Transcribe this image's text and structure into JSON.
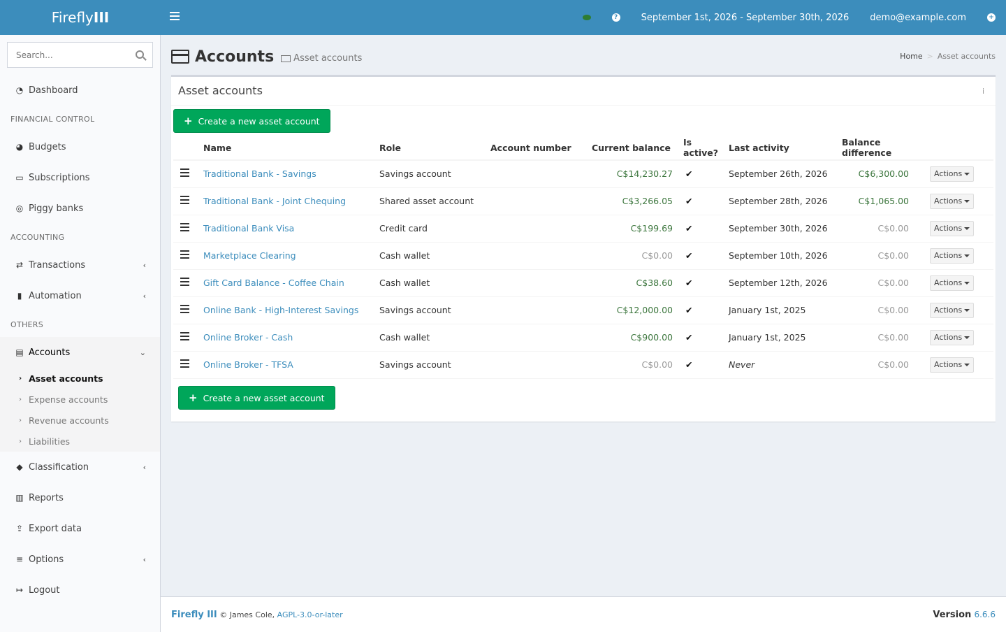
{
  "header": {
    "logo_light": "Firefly",
    "logo_bold": "III",
    "date_range": "September 1st, 2026 - September 30th, 2026",
    "user_email": "demo@example.com"
  },
  "sidebar": {
    "search_placeholder": "Search...",
    "dashboard": "Dashboard",
    "section_financial": "FINANCIAL CONTROL",
    "budgets": "Budgets",
    "subscriptions": "Subscriptions",
    "piggy_banks": "Piggy banks",
    "section_accounting": "ACCOUNTING",
    "transactions": "Transactions",
    "automation": "Automation",
    "section_others": "OTHERS",
    "accounts": "Accounts",
    "sub_asset": "Asset accounts",
    "sub_expense": "Expense accounts",
    "sub_revenue": "Revenue accounts",
    "sub_liabilities": "Liabilities",
    "classification": "Classification",
    "reports": "Reports",
    "export": "Export data",
    "options": "Options",
    "logout": "Logout"
  },
  "page": {
    "title": "Accounts",
    "subtitle": "Asset accounts",
    "breadcrumb_home": "Home",
    "breadcrumb_current": "Asset accounts"
  },
  "box": {
    "title": "Asset accounts",
    "info": "i",
    "create_label": "Create a new asset account"
  },
  "table": {
    "columns": {
      "name": "Name",
      "role": "Role",
      "account_number": "Account number",
      "current_balance": "Current balance",
      "is_active": "Is active?",
      "last_activity": "Last activity",
      "balance_difference": "Balance difference"
    },
    "actions_label": "Actions",
    "rows": [
      {
        "name": "Traditional Bank - Savings",
        "role": "Savings account",
        "account_number": "",
        "balance": "C$14,230.27",
        "active": "✔",
        "last_activity": "September 26th, 2026",
        "difference": "C$6,300.00"
      },
      {
        "name": "Traditional Bank - Joint Chequing",
        "role": "Shared asset account",
        "account_number": "",
        "balance": "C$3,266.05",
        "active": "✔",
        "last_activity": "September 28th, 2026",
        "difference": "C$1,065.00"
      },
      {
        "name": "Traditional Bank Visa",
        "role": "Credit card",
        "account_number": "",
        "balance": "C$199.69",
        "active": "✔",
        "last_activity": "September 30th, 2026",
        "difference": "C$0.00"
      },
      {
        "name": "Marketplace Clearing",
        "role": "Cash wallet",
        "account_number": "",
        "balance": "C$0.00",
        "active": "✔",
        "last_activity": "September 10th, 2026",
        "difference": "C$0.00"
      },
      {
        "name": "Gift Card Balance - Coffee Chain",
        "role": "Cash wallet",
        "account_number": "",
        "balance": "C$38.60",
        "active": "✔",
        "last_activity": "September 12th, 2026",
        "difference": "C$0.00"
      },
      {
        "name": "Online Bank - High-Interest Savings",
        "role": "Savings account",
        "account_number": "",
        "balance": "C$12,000.00",
        "active": "✔",
        "last_activity": "January 1st, 2025",
        "difference": "C$0.00"
      },
      {
        "name": "Online Broker - Cash",
        "role": "Cash wallet",
        "account_number": "",
        "balance": "C$900.00",
        "active": "✔",
        "last_activity": "January 1st, 2025",
        "difference": "C$0.00"
      },
      {
        "name": "Online Broker - TFSA",
        "role": "Savings account",
        "account_number": "",
        "balance": "C$0.00",
        "active": "✔",
        "last_activity": "Never",
        "difference": "C$0.00"
      }
    ]
  },
  "footer": {
    "app_name": "Firefly III",
    "copyright": "© James Cole,",
    "license": "AGPL-3.0-or-later",
    "version_label": "Version",
    "version": "6.6.6"
  },
  "colors": {
    "header_bg": "#3c8dbc",
    "create_button": "#00a65a",
    "positive_money": "#3c763d",
    "zero_money": "#999999",
    "link": "#3c8dbc"
  }
}
